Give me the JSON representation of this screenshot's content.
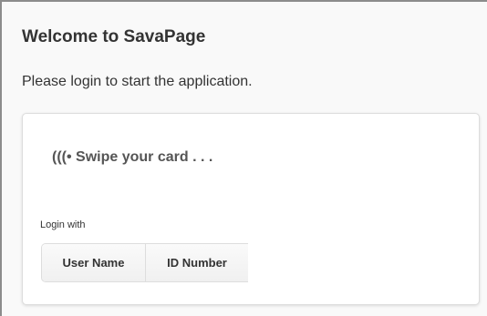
{
  "page": {
    "title": "Welcome to SavaPage",
    "subtitle": "Please login to start the application."
  },
  "login_panel": {
    "swipe_text": "(((• Swipe your card . . .",
    "login_with_label": "Login with",
    "methods": [
      {
        "label": "User Name"
      },
      {
        "label": "ID Number"
      }
    ]
  },
  "colors": {
    "text": "#333333",
    "swipe_text": "#555555",
    "panel_border": "#dddddd",
    "background": "#f9f9f9"
  }
}
